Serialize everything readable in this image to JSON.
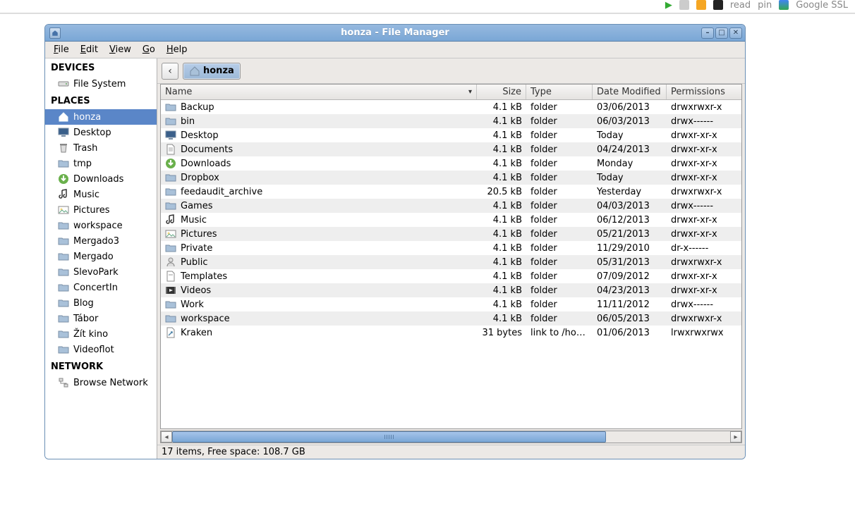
{
  "window": {
    "title": "honza - File Manager"
  },
  "menubar": [
    {
      "label": "File",
      "ul": "F"
    },
    {
      "label": "Edit",
      "ul": "E"
    },
    {
      "label": "View",
      "ul": "V"
    },
    {
      "label": "Go",
      "ul": "G"
    },
    {
      "label": "Help",
      "ul": "H"
    }
  ],
  "sidebar": {
    "sections": [
      {
        "title": "DEVICES",
        "items": [
          {
            "label": "File System",
            "icon": "drive"
          }
        ]
      },
      {
        "title": "PLACES",
        "items": [
          {
            "label": "honza",
            "icon": "home",
            "selected": true
          },
          {
            "label": "Desktop",
            "icon": "desktop"
          },
          {
            "label": "Trash",
            "icon": "trash"
          },
          {
            "label": "tmp",
            "icon": "folder"
          },
          {
            "label": "Downloads",
            "icon": "downloads"
          },
          {
            "label": "Music",
            "icon": "music"
          },
          {
            "label": "Pictures",
            "icon": "pictures"
          },
          {
            "label": "workspace",
            "icon": "folder"
          },
          {
            "label": "Mergado3",
            "icon": "folder"
          },
          {
            "label": "Mergado",
            "icon": "folder"
          },
          {
            "label": "SlevoPark",
            "icon": "folder"
          },
          {
            "label": "ConcertIn",
            "icon": "folder"
          },
          {
            "label": "Blog",
            "icon": "folder"
          },
          {
            "label": "Tábor",
            "icon": "folder"
          },
          {
            "label": "Žít kino",
            "icon": "folder"
          },
          {
            "label": "Videoflot",
            "icon": "folder"
          }
        ]
      },
      {
        "title": "NETWORK",
        "items": [
          {
            "label": "Browse Network",
            "icon": "network"
          }
        ]
      }
    ]
  },
  "nav": {
    "back": "‹",
    "path_label": "honza"
  },
  "columns": {
    "name": "Name",
    "size": "Size",
    "type": "Type",
    "date": "Date Modified",
    "perm": "Permissions"
  },
  "rows": [
    {
      "icon": "folder",
      "name": "Backup",
      "size": "4.1 kB",
      "type": "folder",
      "date": "03/06/2013",
      "perm": "drwxrwxr-x"
    },
    {
      "icon": "folder",
      "name": "bin",
      "size": "4.1 kB",
      "type": "folder",
      "date": "06/03/2013",
      "perm": "drwx------"
    },
    {
      "icon": "desktop",
      "name": "Desktop",
      "size": "4.1 kB",
      "type": "folder",
      "date": "Today",
      "perm": "drwxr-xr-x"
    },
    {
      "icon": "documents",
      "name": "Documents",
      "size": "4.1 kB",
      "type": "folder",
      "date": "04/24/2013",
      "perm": "drwxr-xr-x"
    },
    {
      "icon": "downloads",
      "name": "Downloads",
      "size": "4.1 kB",
      "type": "folder",
      "date": "Monday",
      "perm": "drwxr-xr-x"
    },
    {
      "icon": "folder",
      "name": "Dropbox",
      "size": "4.1 kB",
      "type": "folder",
      "date": "Today",
      "perm": "drwxr-xr-x"
    },
    {
      "icon": "folder",
      "name": "feedaudit_archive",
      "size": "20.5 kB",
      "type": "folder",
      "date": "Yesterday",
      "perm": "drwxrwxr-x"
    },
    {
      "icon": "folder",
      "name": "Games",
      "size": "4.1 kB",
      "type": "folder",
      "date": "04/03/2013",
      "perm": "drwx------"
    },
    {
      "icon": "music",
      "name": "Music",
      "size": "4.1 kB",
      "type": "folder",
      "date": "06/12/2013",
      "perm": "drwxr-xr-x"
    },
    {
      "icon": "pictures",
      "name": "Pictures",
      "size": "4.1 kB",
      "type": "folder",
      "date": "05/21/2013",
      "perm": "drwxr-xr-x"
    },
    {
      "icon": "folder",
      "name": "Private",
      "size": "4.1 kB",
      "type": "folder",
      "date": "11/29/2010",
      "perm": "dr-x------"
    },
    {
      "icon": "public",
      "name": "Public",
      "size": "4.1 kB",
      "type": "folder",
      "date": "05/31/2013",
      "perm": "drwxrwxr-x"
    },
    {
      "icon": "templates",
      "name": "Templates",
      "size": "4.1 kB",
      "type": "folder",
      "date": "07/09/2012",
      "perm": "drwxr-xr-x"
    },
    {
      "icon": "videos",
      "name": "Videos",
      "size": "4.1 kB",
      "type": "folder",
      "date": "04/23/2013",
      "perm": "drwxr-xr-x"
    },
    {
      "icon": "folder",
      "name": "Work",
      "size": "4.1 kB",
      "type": "folder",
      "date": "11/11/2012",
      "perm": "drwx------"
    },
    {
      "icon": "folder",
      "name": "workspace",
      "size": "4.1 kB",
      "type": "folder",
      "date": "06/05/2013",
      "perm": "drwxrwxr-x"
    },
    {
      "icon": "link",
      "name": "Kraken",
      "size": "31 bytes",
      "type": "link to /home/h",
      "date": "01/06/2013",
      "perm": "lrwxrwxrwx"
    }
  ],
  "status": "17 items, Free space: 108.7 GB",
  "topcrumbs": {
    "read": "read",
    "pin": "pin",
    "google": "Google SSL"
  }
}
